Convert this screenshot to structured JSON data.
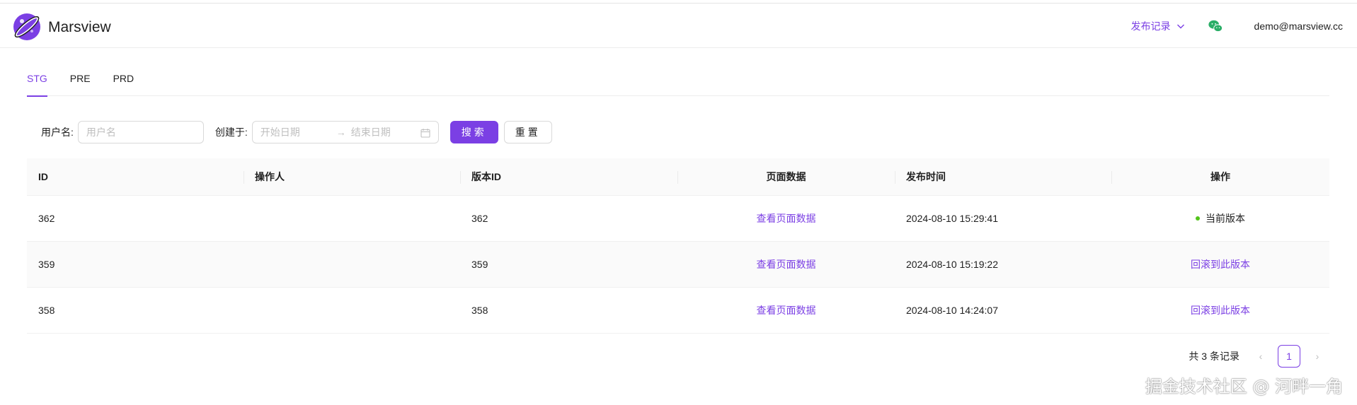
{
  "header": {
    "app_title": "Marsview",
    "publish_menu_label": "发布记录",
    "user_email": "demo@marsview.cc"
  },
  "tabs": [
    {
      "label": "STG",
      "active": true
    },
    {
      "label": "PRE",
      "active": false
    },
    {
      "label": "PRD",
      "active": false
    }
  ],
  "filters": {
    "username_label": "用户名:",
    "username_placeholder": "用户名",
    "created_label": "创建于:",
    "start_placeholder": "开始日期",
    "end_placeholder": "结束日期",
    "search_label": "搜索",
    "reset_label": "重置"
  },
  "table": {
    "columns": [
      "ID",
      "操作人",
      "版本ID",
      "页面数据",
      "发布时间",
      "操作"
    ],
    "rows": [
      {
        "id": "362",
        "operator": "",
        "version_id": "362",
        "page_data": "查看页面数据",
        "time": "2024-08-10 15:29:41",
        "action": "当前版本",
        "current": true
      },
      {
        "id": "359",
        "operator": "",
        "version_id": "359",
        "page_data": "查看页面数据",
        "time": "2024-08-10 15:19:22",
        "action": "回滚到此版本",
        "current": false
      },
      {
        "id": "358",
        "operator": "",
        "version_id": "358",
        "page_data": "查看页面数据",
        "time": "2024-08-10 14:24:07",
        "action": "回滚到此版本",
        "current": false
      }
    ]
  },
  "pagination": {
    "total_text": "共 3 条记录",
    "current_page": "1"
  },
  "watermark": "掘金技术社区 @ 河畔一角",
  "colors": {
    "accent": "#7b3fe4",
    "status_current": "#52c41a",
    "wechat": "#2aae67"
  },
  "icons": [
    "marsview-logo",
    "chevron-down-icon",
    "wechat-icon",
    "calendar-icon",
    "arrow-right-icon",
    "chevron-left-icon",
    "chevron-right-icon",
    "status-dot-icon"
  ]
}
